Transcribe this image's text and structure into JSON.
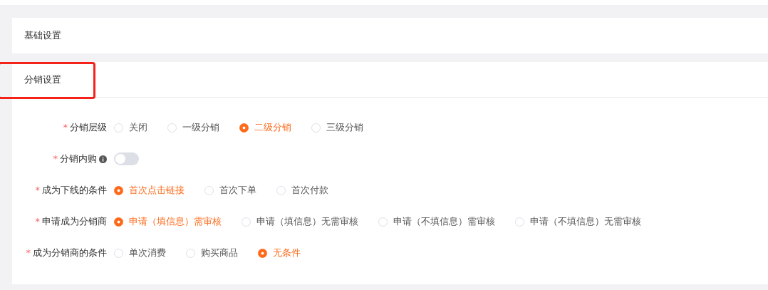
{
  "sections": [
    {
      "title": "基础设置",
      "highlighted": false
    },
    {
      "title": "分销设置",
      "highlighted": true,
      "fields": [
        {
          "kind": "radio",
          "label": "分销层级",
          "required_mark": "*",
          "options": [
            {
              "label": "关闭",
              "selected": false
            },
            {
              "label": "一级分销",
              "selected": false
            },
            {
              "label": "二级分销",
              "selected": true
            },
            {
              "label": "三级分销",
              "selected": false
            }
          ]
        },
        {
          "kind": "switch",
          "label": "分销内购",
          "required_mark": "*",
          "info": true,
          "on": false
        },
        {
          "kind": "radio",
          "label": "成为下线的条件",
          "required_mark": "*",
          "options": [
            {
              "label": "首次点击链接",
              "selected": true
            },
            {
              "label": "首次下单",
              "selected": false
            },
            {
              "label": "首次付款",
              "selected": false
            }
          ]
        },
        {
          "kind": "radio",
          "label": "申请成为分销商",
          "required_mark": "*",
          "options": [
            {
              "label": "申请（填信息）需审核",
              "selected": true
            },
            {
              "label": "申请（填信息）无需审核",
              "selected": false
            },
            {
              "label": "申请（不填信息）需审核",
              "selected": false
            },
            {
              "label": "申请（不填信息）无需审核",
              "selected": false
            }
          ]
        },
        {
          "kind": "radio",
          "label": "成为分销商的条件",
          "required_mark": "*",
          "options": [
            {
              "label": "单次消费",
              "selected": false
            },
            {
              "label": "购买商品",
              "selected": false
            },
            {
              "label": "无条件",
              "selected": true
            }
          ]
        }
      ]
    }
  ]
}
